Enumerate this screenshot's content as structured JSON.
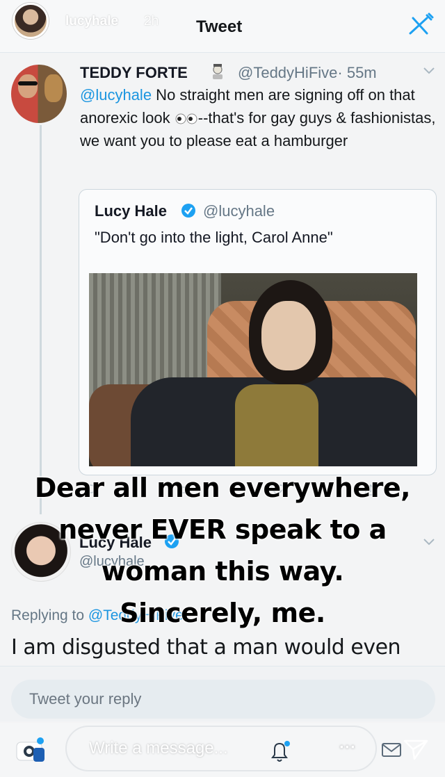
{
  "story": {
    "username": "lucyhale",
    "time": "2h"
  },
  "header": {
    "title": "Tweet"
  },
  "tweet": {
    "author_name": "TEDDY FORTE",
    "author_handle": "@TeddyHiFive",
    "time": "· 55m",
    "mention": "@lucyhale",
    "text_part1": " No straight men are signing off on that anorexic look ",
    "text_part2": "--that's for gay guys & fashionistas, we want you to please eat a hamburger"
  },
  "quoted_tweet": {
    "name": "Lucy Hale",
    "handle": "@lucyhale",
    "text": "\"Don't go into the light, Carol Anne\""
  },
  "reply": {
    "name": "Lucy Hale",
    "handle": "@lucyhale",
    "replying_to_label": "Replying to ",
    "replying_to_handle": "@TeddyHiFive",
    "text": "I am disgusted that a man would even"
  },
  "caption": {
    "line1": "Dear all men everywhere,",
    "line2": "never EVER speak to a",
    "line3": "woman this way.",
    "line4": "Sincerely, me."
  },
  "composer": {
    "placeholder": "Tweet your reply"
  },
  "story_bar": {
    "message_placeholder": "Write a message...",
    "more": "···"
  },
  "colors": {
    "accent": "#1b95e0",
    "secondary_text": "#657786",
    "verified": "#1da1f2"
  },
  "icons": [
    "compose-icon",
    "eyes-emoji-icon",
    "verified-badge-icon",
    "chevron-down-icon",
    "reply-icon",
    "retweet-icon",
    "like-icon",
    "share-icon",
    "camera-icon",
    "bell-icon",
    "more-icon",
    "dm-icon",
    "send-icon"
  ]
}
